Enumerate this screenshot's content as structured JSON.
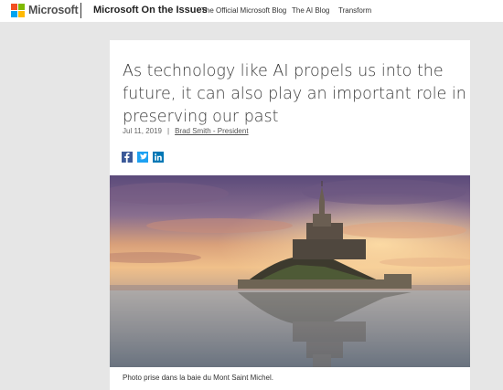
{
  "header": {
    "brand": "Microsoft",
    "site_title": "Microsoft On the Issues",
    "nav": [
      "The Official Microsoft Blog",
      "The AI Blog",
      "Transform"
    ]
  },
  "article": {
    "headline": "As technology like AI propels us into the future, it can also play an important role in preserving our past",
    "date": "Jul 11, 2019",
    "separator": "|",
    "author": "Brad Smith - President",
    "share_icons": [
      "facebook-icon",
      "twitter-icon",
      "linkedin-icon"
    ],
    "image_caption": "Photo prise dans la baie du Mont Saint Michel."
  },
  "colors": {
    "facebook": "#3b5998",
    "twitter": "#1da1f2",
    "linkedin": "#0077b5",
    "logo_red": "#f25022",
    "logo_green": "#7fba00",
    "logo_blue": "#00a4ef",
    "logo_yellow": "#ffb900"
  }
}
